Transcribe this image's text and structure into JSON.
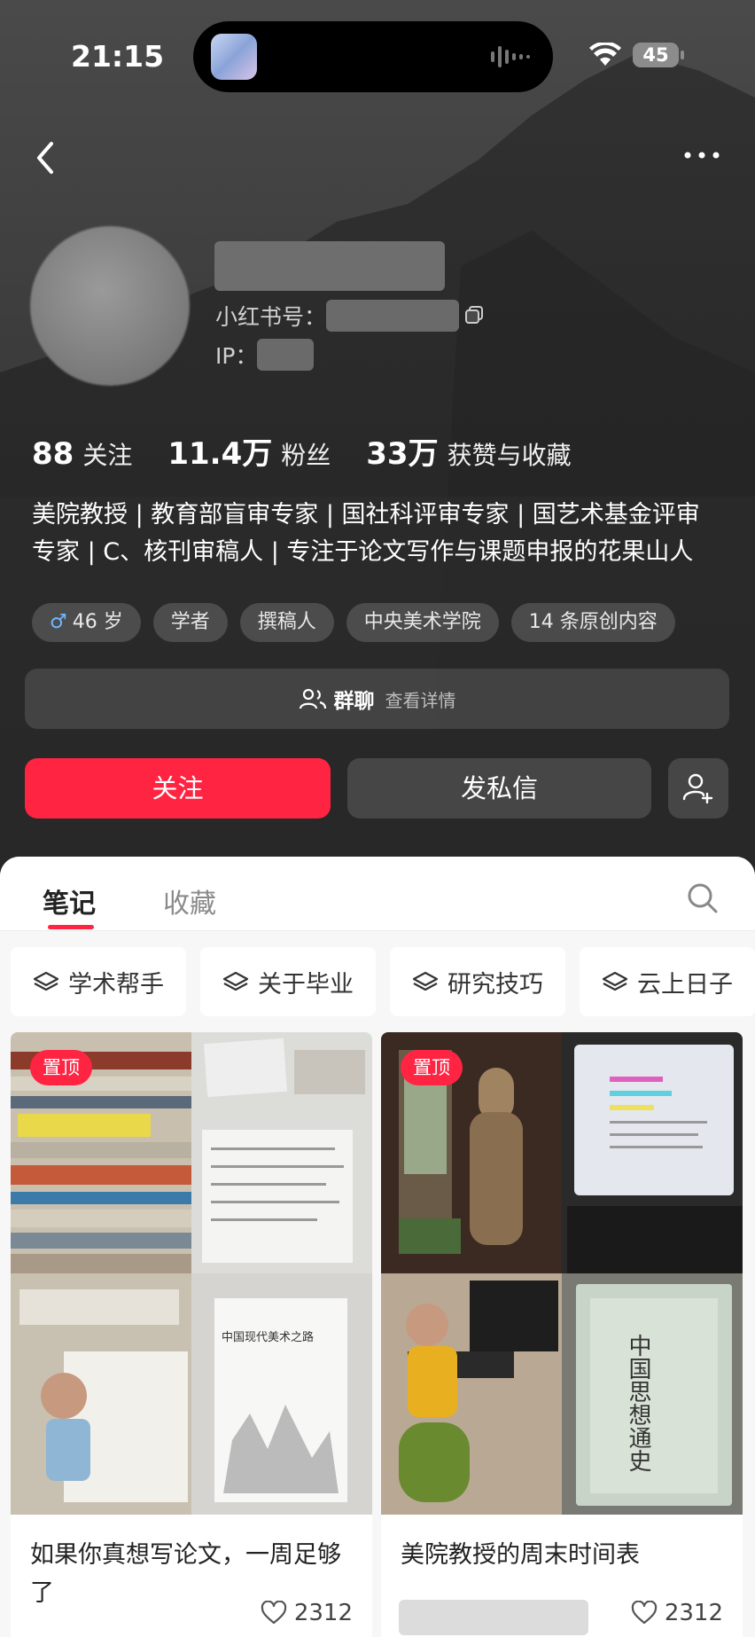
{
  "status_bar": {
    "time": "21:15",
    "battery": "45"
  },
  "profile": {
    "id_label": "小红书号：",
    "ip_label": "IP：",
    "stats": [
      {
        "value": "88",
        "label": "关注"
      },
      {
        "value": "11.4万",
        "label": "粉丝"
      },
      {
        "value": "33万",
        "label": "获赞与收藏"
      }
    ],
    "bio_line1": "美院教授 | 教育部盲审专家 | 国社科评审专家 | 国艺术基金评审",
    "bio_line2": "专家 | C、核刊审稿人 | 专注于论文写作与课题申报的花果山人",
    "tags": [
      "46 岁",
      "学者",
      "撰稿人",
      "中央美术学院",
      "14 条原创内容"
    ],
    "group_title": "群聊",
    "group_sub": "查看详情",
    "follow_label": "关注",
    "dm_label": "发私信"
  },
  "tabs": {
    "active": "笔记",
    "inactive": "收藏"
  },
  "chips": [
    "学术帮手",
    "关于毕业",
    "研究技巧",
    "云上日子"
  ],
  "cards": [
    {
      "pin": "置顶",
      "title": "如果你真想写论文，一周足够了",
      "likes": "2312",
      "book_title": "中国现代美术之路"
    },
    {
      "pin": "置顶",
      "title": "美院教授的周末时间表",
      "likes": "2312",
      "book_title": "中国思想通史"
    }
  ],
  "colors": {
    "accent": "#ff2442"
  }
}
